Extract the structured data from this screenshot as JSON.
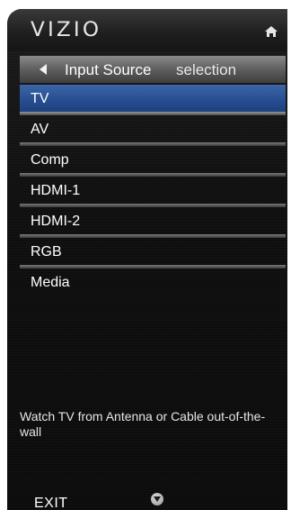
{
  "brand": {
    "logo_text": "VIZIO"
  },
  "topbar": {
    "home_icon": "home-icon"
  },
  "header": {
    "title": "Input Source",
    "subtitle": "selection",
    "back_icon": "back-arrow-icon"
  },
  "menu": {
    "selected_index": 0,
    "items": [
      {
        "label": "TV"
      },
      {
        "label": "AV"
      },
      {
        "label": "Comp"
      },
      {
        "label": "HDMI-1"
      },
      {
        "label": "HDMI-2"
      },
      {
        "label": "RGB"
      },
      {
        "label": "Media"
      }
    ]
  },
  "help": {
    "text": "Watch TV from Antenna or Cable out-of-the-wall"
  },
  "footer": {
    "exit_label": "EXIT",
    "down_icon": "scroll-down-icon"
  },
  "colors": {
    "selected": "#274e90",
    "background": "#0f0f0f",
    "header": "#5e5e5e"
  }
}
